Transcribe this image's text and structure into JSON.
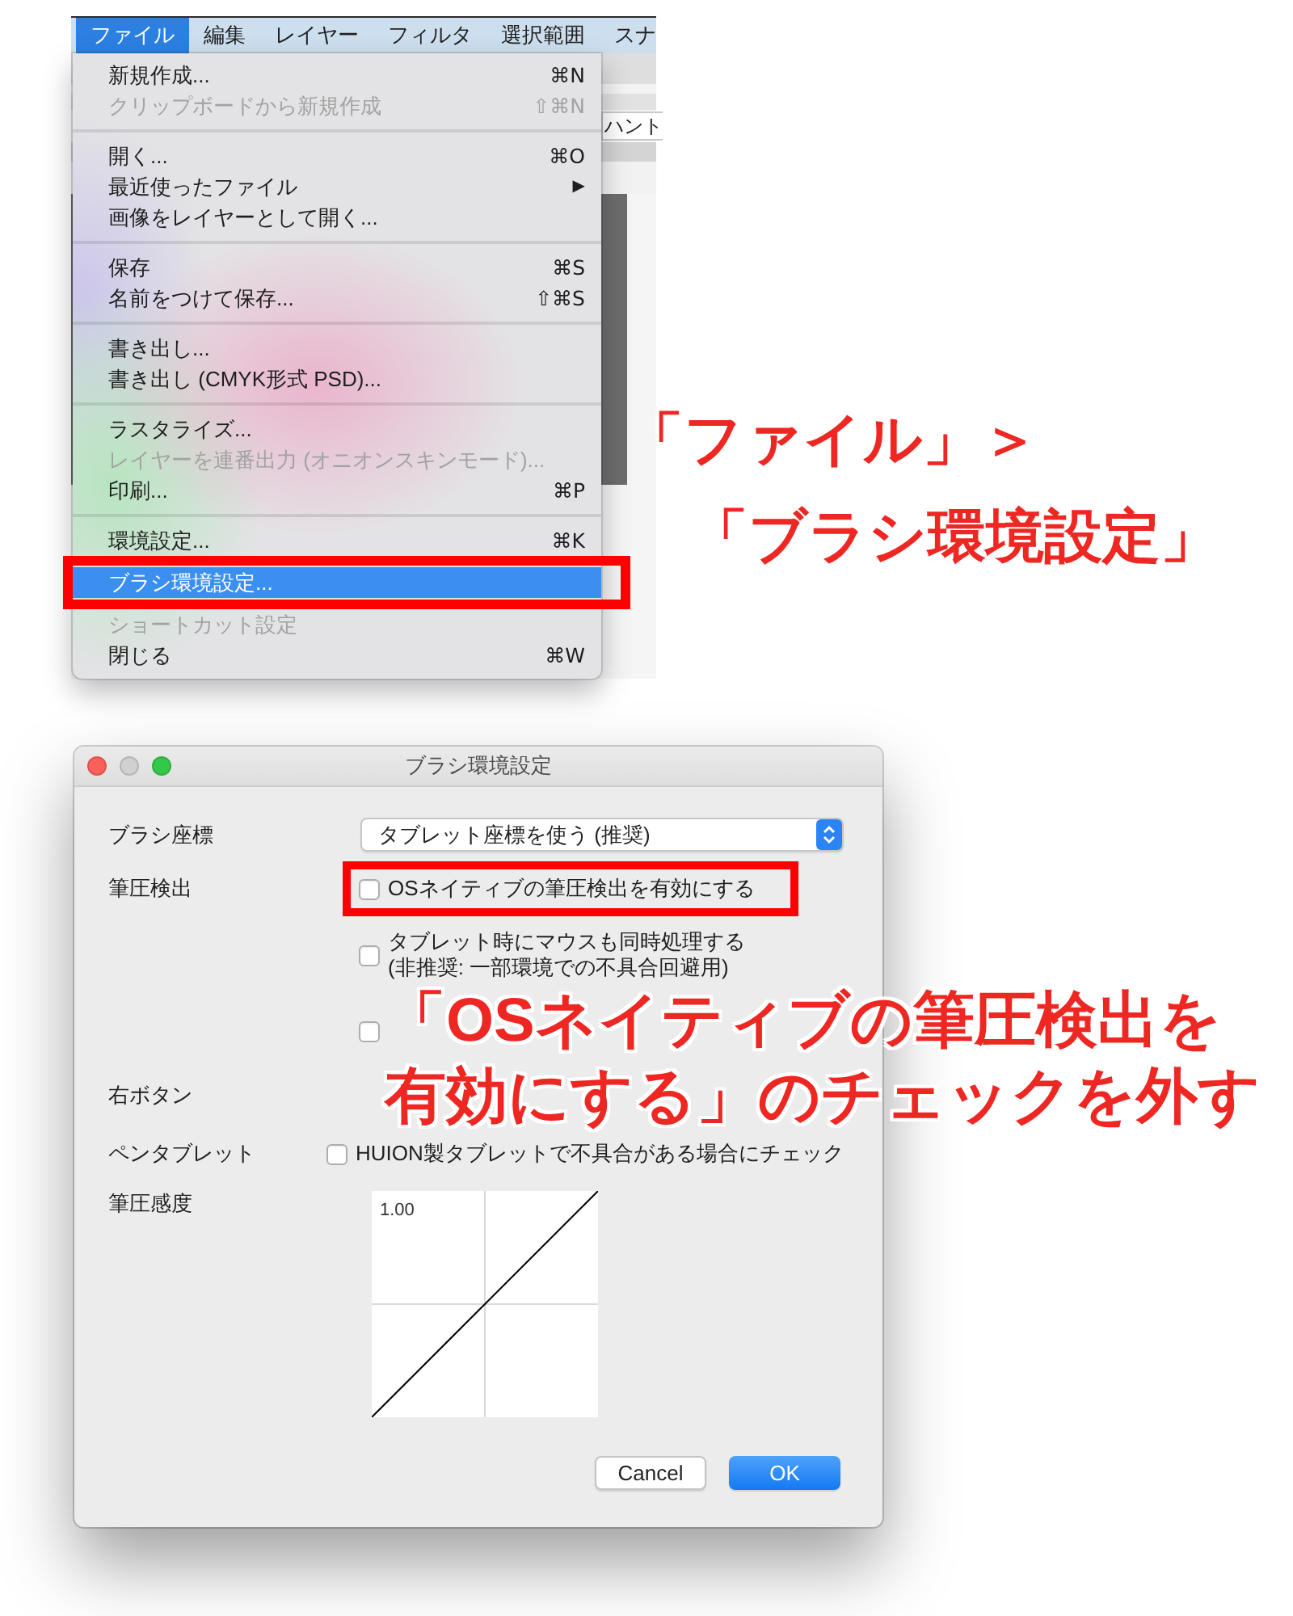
{
  "menu_screenshot": {
    "menubar": [
      {
        "label": "ファイル",
        "selected": true
      },
      {
        "label": "編集",
        "selected": false
      },
      {
        "label": "レイヤー",
        "selected": false
      },
      {
        "label": "フィルタ",
        "selected": false
      },
      {
        "label": "選択範囲",
        "selected": false
      },
      {
        "label": "スナ",
        "selected": false
      }
    ],
    "toolbar_field": "ハント",
    "menu": [
      {
        "kind": "item",
        "label": "新規作成...",
        "shortcut": "⌘N",
        "disabled": false,
        "selected": false,
        "framed": false
      },
      {
        "kind": "item",
        "label": "クリップボードから新規作成",
        "shortcut": "⇧⌘N",
        "disabled": true,
        "selected": false,
        "framed": false
      },
      {
        "kind": "separator"
      },
      {
        "kind": "item",
        "label": "開く...",
        "shortcut": "⌘O",
        "disabled": false,
        "selected": false,
        "framed": false
      },
      {
        "kind": "item",
        "label": "最近使ったファイル",
        "arrow": "▶",
        "disabled": false,
        "selected": false,
        "framed": false
      },
      {
        "kind": "item",
        "label": "画像をレイヤーとして開く...",
        "disabled": false,
        "selected": false,
        "framed": false
      },
      {
        "kind": "separator"
      },
      {
        "kind": "item",
        "label": "保存",
        "shortcut": "⌘S",
        "disabled": false,
        "selected": false,
        "framed": false
      },
      {
        "kind": "item",
        "label": "名前をつけて保存...",
        "shortcut": "⇧⌘S",
        "disabled": false,
        "selected": false,
        "framed": false
      },
      {
        "kind": "separator"
      },
      {
        "kind": "item",
        "label": "書き出し...",
        "disabled": false,
        "selected": false,
        "framed": false
      },
      {
        "kind": "item",
        "label": "書き出し (CMYK形式 PSD)...",
        "disabled": false,
        "selected": false,
        "framed": false
      },
      {
        "kind": "separator"
      },
      {
        "kind": "item",
        "label": "ラスタライズ...",
        "disabled": false,
        "selected": false,
        "framed": false
      },
      {
        "kind": "item",
        "label": "レイヤーを連番出力 (オニオンスキンモード)...",
        "disabled": true,
        "selected": false,
        "framed": false
      },
      {
        "kind": "item",
        "label": "印刷...",
        "shortcut": "⌘P",
        "disabled": false,
        "selected": false,
        "framed": false
      },
      {
        "kind": "separator"
      },
      {
        "kind": "item",
        "label": "環境設定...",
        "shortcut": "⌘K",
        "disabled": false,
        "selected": false,
        "framed": false
      },
      {
        "kind": "item",
        "label": "ブラシ環境設定...",
        "disabled": false,
        "selected": true,
        "framed": true
      },
      {
        "kind": "item",
        "label": "ショートカット設定",
        "disabled": true,
        "selected": false,
        "framed": false
      },
      {
        "kind": "item",
        "label": "閉じる",
        "shortcut": "⌘W",
        "disabled": false,
        "selected": false,
        "framed": false
      }
    ],
    "callout": {
      "lines": [
        "「ファイル」＞",
        "「ブラシ環境設定」"
      ]
    }
  },
  "dialog": {
    "title": "ブラシ環境設定",
    "window_controls": [
      {
        "kind": "close",
        "disabled": false
      },
      {
        "kind": "minimize",
        "disabled": true
      },
      {
        "kind": "zoom",
        "disabled": false
      }
    ],
    "rows": [
      {
        "label": "ブラシ座標",
        "kind": "select",
        "value": "タブレット座標を使う (推奨)"
      },
      {
        "label": "筆圧検出",
        "kind": "checks",
        "options": [
          {
            "label": "OSネイティブの筆圧検出を有効にする",
            "checked": false,
            "framed": true
          },
          {
            "label": "タブレット時にマウスも同時処理する",
            "note": "(非推奨: 一部環境での不具合回避用)",
            "checked": false,
            "framed": false
          },
          {
            "checked": false,
            "framed": false
          }
        ]
      },
      {
        "label": "右ボタン",
        "kind": "label"
      },
      {
        "label": "ペンタブレット",
        "kind": "check",
        "option": {
          "label": "HUION製タブレットで不具合がある場合にチェック",
          "checked": false
        }
      },
      {
        "label": "筆圧感度",
        "kind": "curve",
        "max_label": "1.00"
      }
    ],
    "buttons": [
      {
        "label": "Cancel",
        "kind": "default"
      },
      {
        "label": "OK",
        "kind": "primary"
      }
    ],
    "callout": {
      "lines": [
        "「OSネイティブの筆圧検出を",
        "有効にする」のチェックを外す"
      ]
    }
  }
}
